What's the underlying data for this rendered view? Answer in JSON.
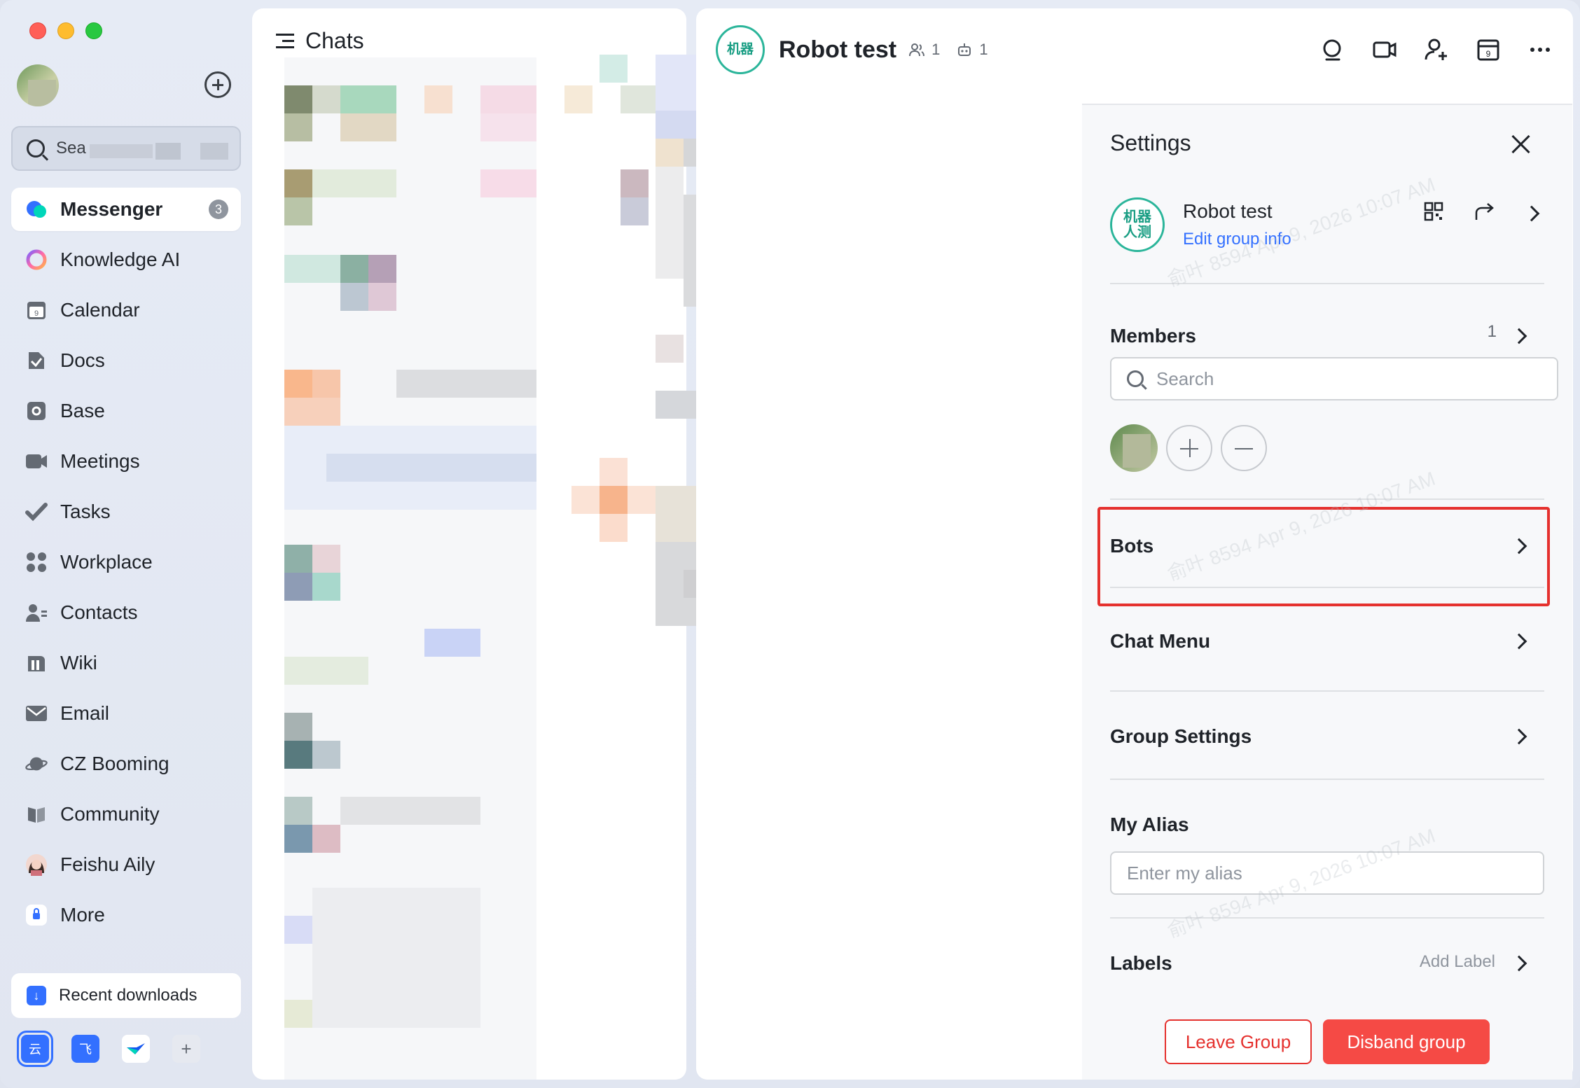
{
  "sidebar": {
    "search_placeholder": "Sea",
    "items": [
      {
        "label": "Messenger",
        "badge": "3",
        "icon": "messenger-icon"
      },
      {
        "label": "Knowledge AI",
        "icon": "knowledge-ai-icon"
      },
      {
        "label": "Calendar",
        "icon": "calendar-icon"
      },
      {
        "label": "Docs",
        "icon": "docs-icon"
      },
      {
        "label": "Base",
        "icon": "base-icon"
      },
      {
        "label": "Meetings",
        "icon": "meetings-icon"
      },
      {
        "label": "Tasks",
        "icon": "tasks-icon"
      },
      {
        "label": "Workplace",
        "icon": "workplace-icon"
      },
      {
        "label": "Contacts",
        "icon": "contacts-icon"
      },
      {
        "label": "Wiki",
        "icon": "wiki-icon"
      },
      {
        "label": "Email",
        "icon": "email-icon"
      },
      {
        "label": "CZ Booming",
        "icon": "planet-icon"
      },
      {
        "label": "Community",
        "icon": "community-icon"
      },
      {
        "label": "Feishu Aily",
        "icon": "aily-avatar-icon"
      },
      {
        "label": "More",
        "icon": "more-icon"
      }
    ],
    "downloads_label": "Recent downloads",
    "calendar_day": "9"
  },
  "chats": {
    "title": "Chats"
  },
  "chat": {
    "title": "Robot test",
    "avatar_text": "机器人测",
    "avatar_text_short": "机器",
    "member_count": "1",
    "bot_count": "1"
  },
  "settings": {
    "title": "Settings",
    "group_name": "Robot test",
    "edit_group_info": "Edit group info",
    "members_label": "Members",
    "members_count": "1",
    "members_search_placeholder": "Search",
    "bots_label": "Bots",
    "chat_menu_label": "Chat Menu",
    "group_settings_label": "Group Settings",
    "my_alias_label": "My Alias",
    "alias_placeholder": "Enter my alias",
    "labels_label": "Labels",
    "add_label": "Add Label",
    "leave_group": "Leave Group",
    "disband_group": "Disband group"
  },
  "watermark": "俞叶 8594 Apr 9, 2026 10:07 AM",
  "colors": {
    "accent": "#3370ff",
    "danger": "#f54a45",
    "highlight_border": "#e5312e",
    "group_avatar": "#2bb59a"
  }
}
